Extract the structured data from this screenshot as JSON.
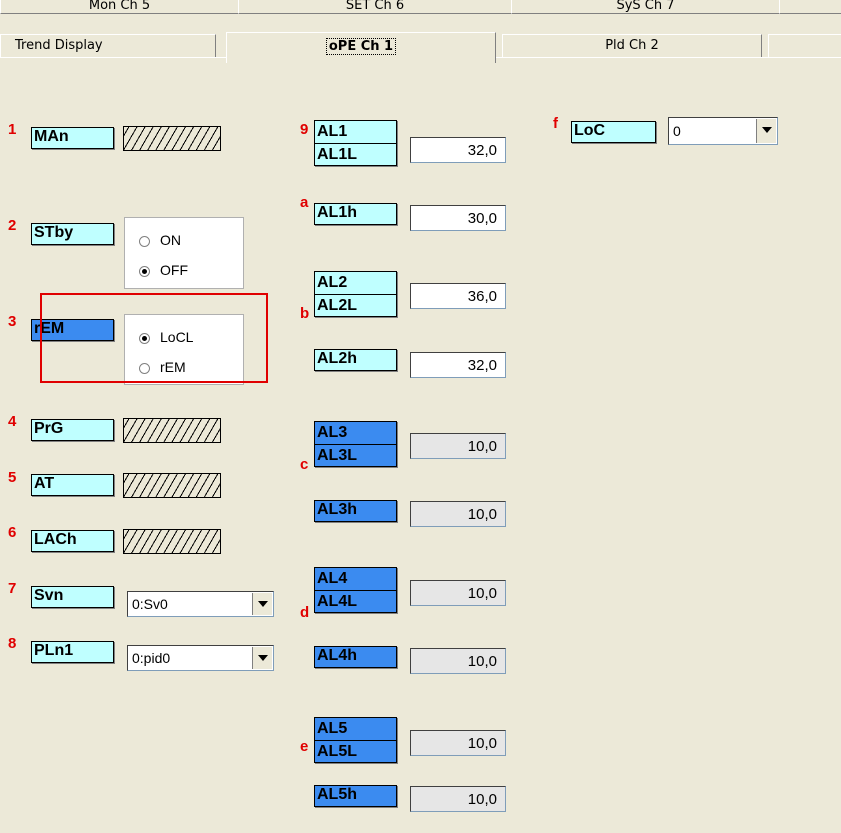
{
  "tabs_back": [
    "Mon Ch 5",
    "SET Ch 6",
    "SyS Ch 7"
  ],
  "tabs_front": [
    "Trend Display",
    "oPE Ch 1",
    "Pld Ch 2"
  ],
  "markers": {
    "m1": "1",
    "m2": "2",
    "m3": "3",
    "m4": "4",
    "m5": "5",
    "m6": "6",
    "m7": "7",
    "m8": "8",
    "m9": "9",
    "ma": "a",
    "mb": "b",
    "mc": "c",
    "md": "d",
    "me": "e",
    "mf": "f"
  },
  "left": {
    "man": "MAn",
    "stby": "STby",
    "stby_opt1": "ON",
    "stby_opt2": "OFF",
    "rem": "rEM",
    "rem_opt1": "LoCL",
    "rem_opt2": "rEM",
    "prg": "PrG",
    "at": "AT",
    "lach": "LACh",
    "svn": "Svn",
    "svn_value": "0:Sv0",
    "pln1": "PLn1",
    "pln1_value": "0:pid0"
  },
  "alarms": {
    "al1": "AL1",
    "al1l": "AL1L",
    "al1l_value": "32,0",
    "al1h": "AL1h",
    "al1h_value": "30,0",
    "al2": "AL2",
    "al2l": "AL2L",
    "al2l_value": "36,0",
    "al2h": "AL2h",
    "al2h_value": "32,0",
    "al3": "AL3",
    "al3l": "AL3L",
    "al3l_value": "10,0",
    "al3h": "AL3h",
    "al3h_value": "10,0",
    "al4": "AL4",
    "al4l": "AL4L",
    "al4l_value": "10,0",
    "al4h": "AL4h",
    "al4h_value": "10,0",
    "al5": "AL5",
    "al5l": "AL5L",
    "al5l_value": "10,0",
    "al5h": "AL5h",
    "al5h_value": "10,0"
  },
  "right": {
    "loc": "LoC",
    "loc_value": "0"
  },
  "colors": {
    "background": "#ece9d8",
    "label_light": "#bfffff",
    "label_dark": "#3b8bf0",
    "marker": "#e00000"
  }
}
